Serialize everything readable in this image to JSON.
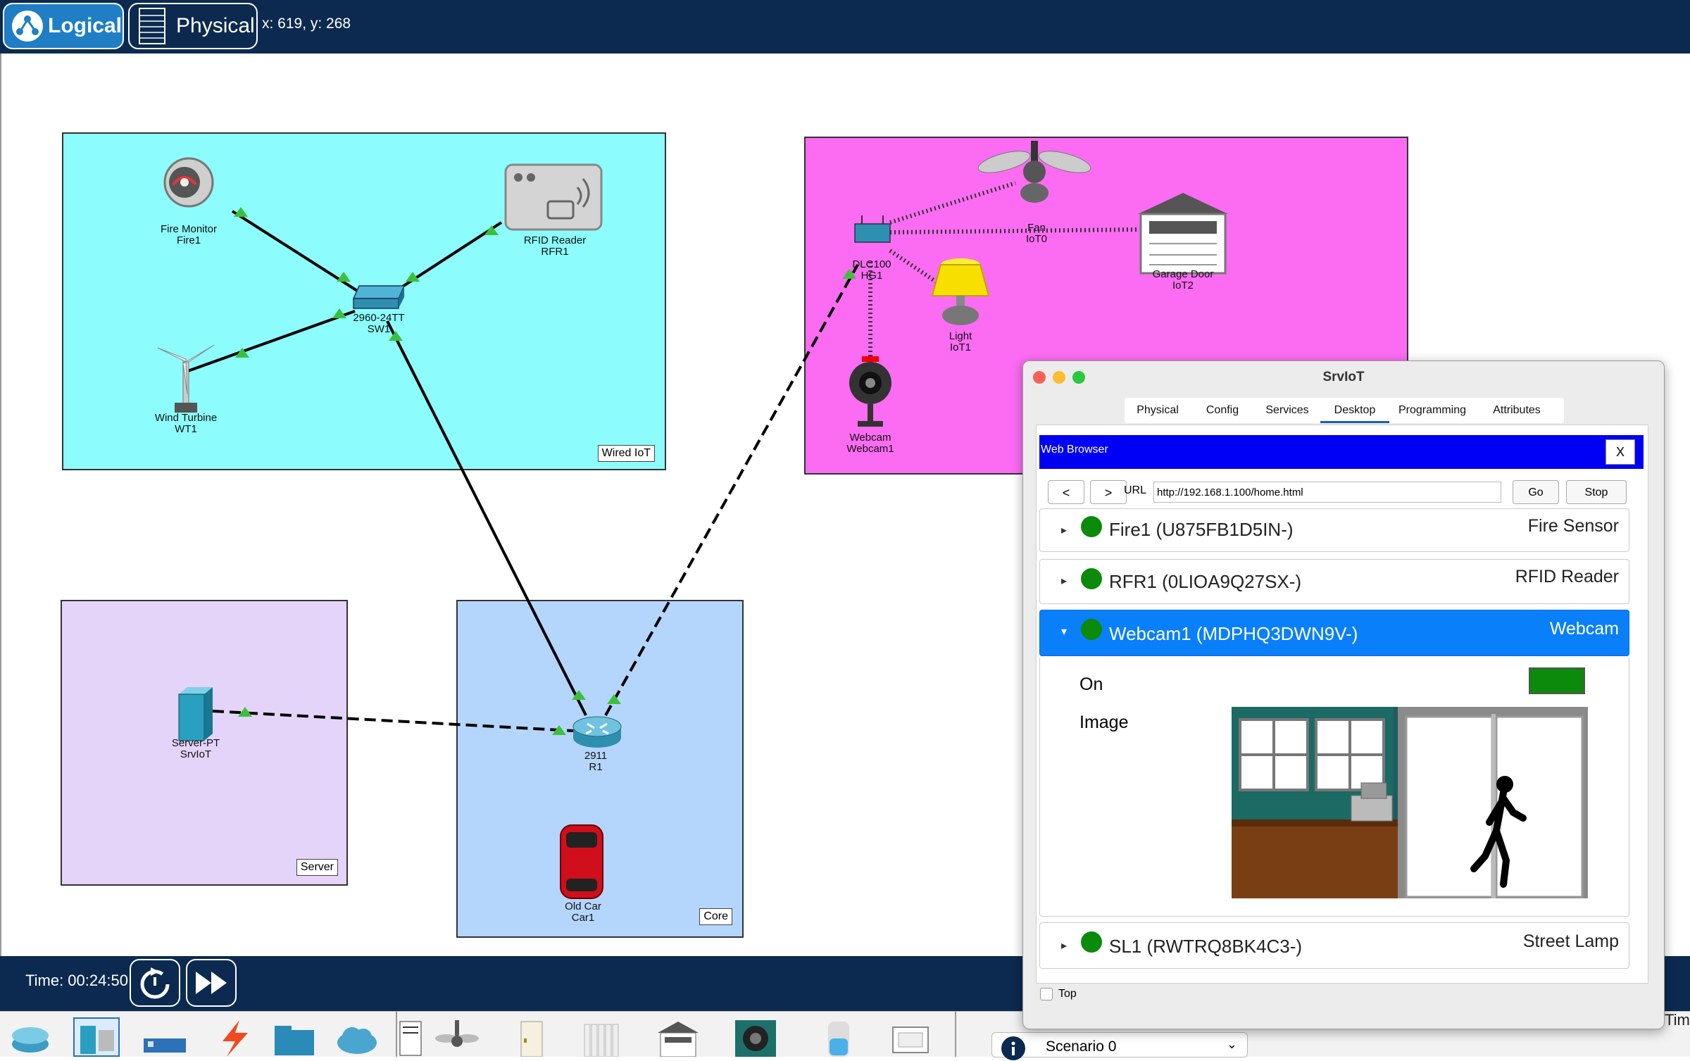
{
  "topbar": {
    "logical_label": "Logical",
    "physical_label": "Physical",
    "coords": "x: 619, y: 268"
  },
  "clusters": {
    "wired_iot": "Wired IoT",
    "server": "Server",
    "core": "Core"
  },
  "devices": {
    "fire_monitor": {
      "model": "Fire Monitor",
      "name": "Fire1"
    },
    "rfid_reader": {
      "model": "RFID Reader",
      "name": "RFR1"
    },
    "switch": {
      "model": "2960-24TT",
      "name": "SW1"
    },
    "wind_turbine": {
      "model": "Wind Turbine",
      "name": "WT1"
    },
    "fan": {
      "model": "Fan",
      "name": "IoT0"
    },
    "garage_door": {
      "model": "Garage Door",
      "name": "IoT2"
    },
    "home_gateway": {
      "model": "DLC100",
      "name": "HG1"
    },
    "light": {
      "model": "Light",
      "name": "IoT1"
    },
    "webcam": {
      "model": "Webcam",
      "name": "Webcam1"
    },
    "server": {
      "model": "Server-PT",
      "name": "SrvIoT"
    },
    "router": {
      "model": "2911",
      "name": "R1"
    },
    "old_car": {
      "model": "Old Car",
      "name": "Car1"
    }
  },
  "bottombar": {
    "time": "Time: 00:24:50",
    "scenario": "Scenario 0",
    "right_edge_text": "Tim"
  },
  "dialog": {
    "title": "SrvIoT",
    "tabs": [
      "Physical",
      "Config",
      "Services",
      "Desktop",
      "Programming",
      "Attributes"
    ],
    "active_tab": "Desktop",
    "web_browser_title": "Web Browser",
    "close_label": "X",
    "back_label": "<",
    "forward_label": ">",
    "url_label": "URL",
    "url_value": "http://192.168.1.100/home.html",
    "go_label": "Go",
    "stop_label": "Stop",
    "rows": [
      {
        "name": "Fire1 (U875FB1D5IN-)",
        "type": "Fire Sensor"
      },
      {
        "name": "RFR1 (0LIOA9Q27SX-)",
        "type": "RFID Reader"
      },
      {
        "name": "Webcam1 (MDPHQ3DWN9V-)",
        "type": "Webcam"
      },
      {
        "name": "SL1 (RWTRQ8BK4C3-)",
        "type": "Street Lamp"
      }
    ],
    "webcam_on_label": "On",
    "webcam_image_label": "Image",
    "top_label": "Top"
  },
  "colors": {
    "navy": "#0c2a4f",
    "wired_iot_bg": "#8cfcfc",
    "home_bg": "#fb6cf2",
    "server_bg": "#e5d4fa",
    "core_bg": "#b5d6fc",
    "status_green": "#0b8a0b",
    "selected_row": "#0a7ffa"
  }
}
